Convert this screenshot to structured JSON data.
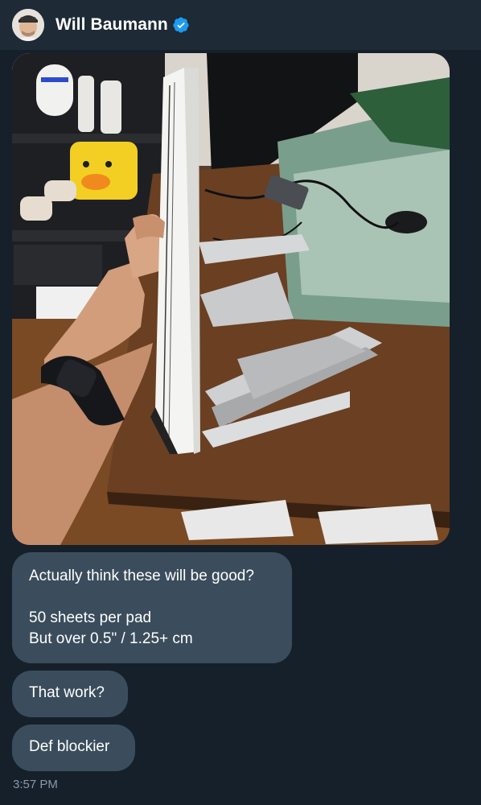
{
  "header": {
    "name": "Will Baumann",
    "verified": true
  },
  "messages": [
    {
      "type": "image",
      "alt_icon": "photo"
    },
    {
      "type": "text",
      "lines": [
        "Actually think these will be good?",
        "",
        "50 sheets per pad",
        "But over 0.5\" / 1.25+ cm"
      ]
    },
    {
      "type": "text",
      "lines": [
        "That work?"
      ]
    },
    {
      "type": "text",
      "lines": [
        "Def blockier"
      ]
    }
  ],
  "timestamp": "3:57 PM",
  "colors": {
    "background": "#15202b",
    "header": "#1e2a36",
    "bubble": "#3b4d5c",
    "verified": "#1d9bf0",
    "timestamp": "#8b98a5"
  }
}
